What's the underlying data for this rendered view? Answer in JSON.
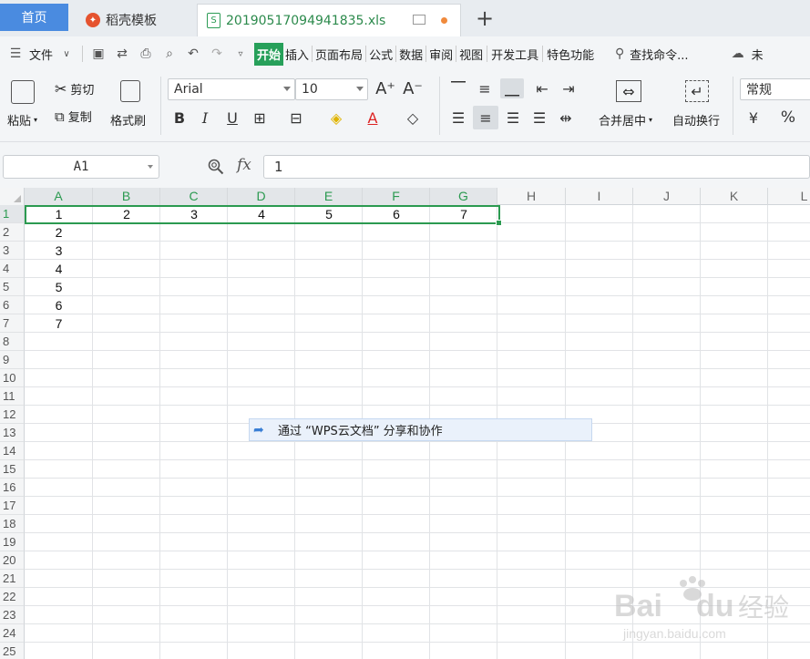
{
  "tabs": {
    "home": "首页",
    "template": "稻壳模板",
    "file": "20190517094941835.xls",
    "add": "+"
  },
  "menu": {
    "file_label": "文件",
    "items": [
      "开始",
      "插入",
      "页面布局",
      "公式",
      "数据",
      "审阅",
      "视图",
      "开发工具",
      "特色功能"
    ],
    "search": "查找命令...",
    "cloud": "未"
  },
  "ribbon": {
    "paste": "粘贴",
    "cut": "剪切",
    "copy": "复制",
    "format_painter": "格式刷",
    "font_name": "Arial",
    "font_size": "10",
    "bold": "B",
    "italic": "I",
    "underline": "U",
    "merge_center": "合并居中",
    "wrap_text": "自动换行",
    "number_format": "常规",
    "percent": "%"
  },
  "formula": {
    "cell_ref": "A1",
    "fx": "fx",
    "value": "1"
  },
  "columns": [
    "A",
    "B",
    "C",
    "D",
    "E",
    "F",
    "G",
    "H",
    "I",
    "J",
    "K",
    "L"
  ],
  "rows": [
    "1",
    "2",
    "3",
    "4",
    "5",
    "6",
    "7",
    "8",
    "9",
    "10",
    "11",
    "12",
    "13",
    "14",
    "15",
    "16",
    "17",
    "18",
    "19",
    "20",
    "21",
    "22",
    "23",
    "24",
    "25"
  ],
  "cells": {
    "row1": [
      "1",
      "2",
      "3",
      "4",
      "5",
      "6",
      "7"
    ],
    "colA": [
      "2",
      "3",
      "4",
      "5",
      "6",
      "7"
    ]
  },
  "share_tip": "通过 “WPS云文档” 分享和协作",
  "colors": {
    "accent_green": "#2b9a50",
    "home_tab": "#4a8be0"
  }
}
